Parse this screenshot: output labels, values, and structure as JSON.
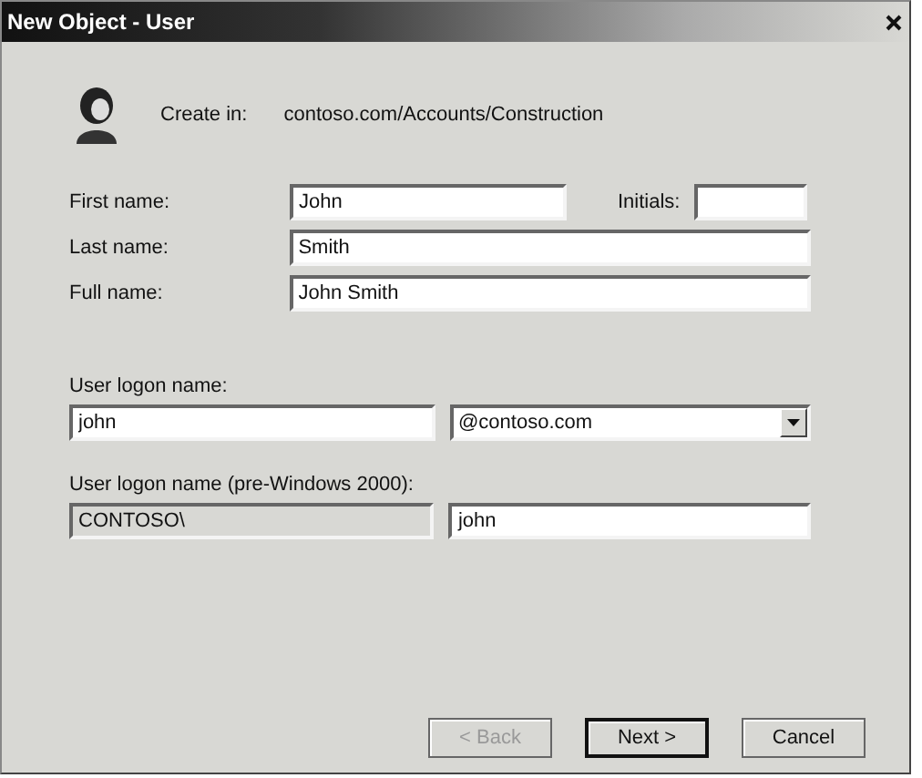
{
  "window": {
    "title": "New Object - User"
  },
  "create_in": {
    "label": "Create in:",
    "path": "contoso.com/Accounts/Construction"
  },
  "first_name": {
    "label": "First name:",
    "value": "John"
  },
  "initials": {
    "label": "Initials:"
  },
  "last_name": {
    "label": "Last name:",
    "value": "Smith"
  },
  "full_name": {
    "label": "Full name:",
    "value": "John Smith"
  },
  "logon": {
    "label": "User logon name:",
    "value": "john",
    "domain": "@contoso.com"
  },
  "pre2000": {
    "label": "User logon name (pre-Windows 2000):",
    "domain": "CONTOSO\\",
    "domain_disabled": true,
    "value": "john"
  },
  "buttons": [
    {
      "label": "< Back",
      "disabled": true,
      "default": false
    },
    {
      "label": "Next >",
      "disabled": false,
      "default": true
    },
    {
      "label": "Cancel",
      "disabled": false,
      "default": false
    }
  ]
}
